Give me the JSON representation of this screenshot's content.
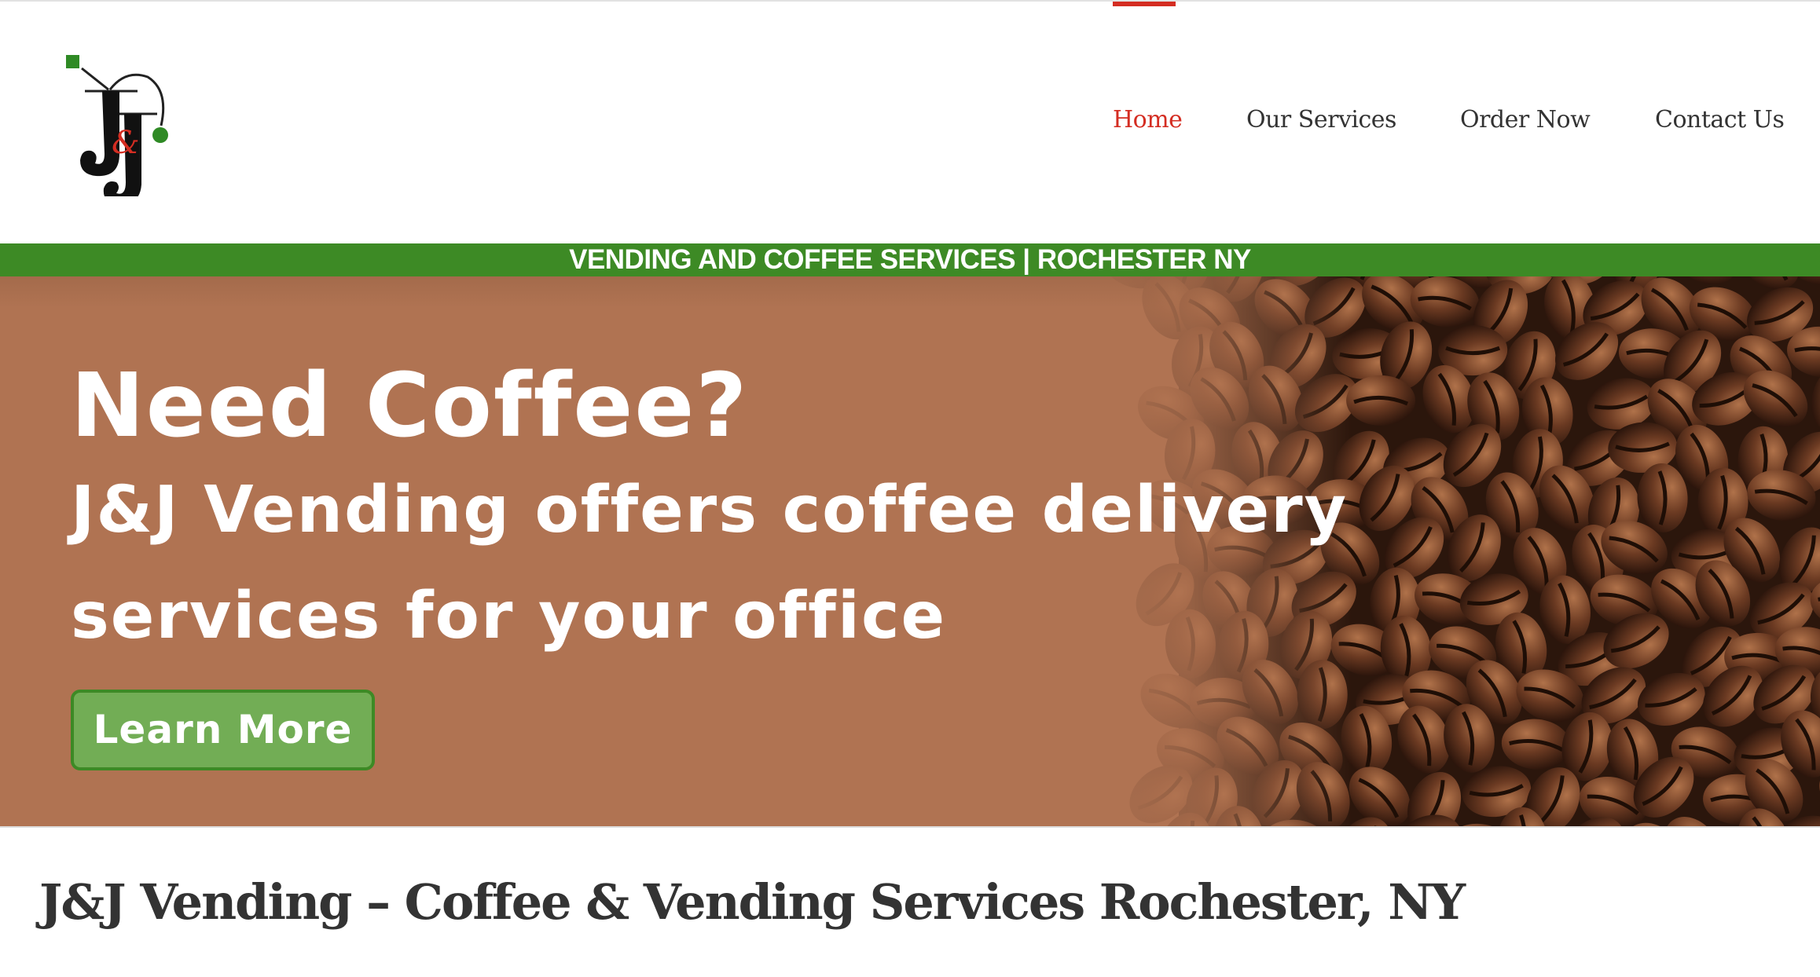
{
  "logo": {
    "text": "J&J",
    "colors": {
      "black": "#111111",
      "red": "#d42d22",
      "green": "#2f8a25"
    }
  },
  "nav": {
    "items": [
      {
        "label": "Home",
        "active": true
      },
      {
        "label": "Our Services"
      },
      {
        "label": "Order Now"
      },
      {
        "label": "Contact Us"
      }
    ]
  },
  "strip": {
    "text": "VENDING AND COFFEE SERVICES | ROCHESTER NY"
  },
  "hero": {
    "heading": "Need Coffee?",
    "line1": "J&J Vending offers coffee delivery",
    "line2": "services for your office",
    "button": "Learn More",
    "image": "coffee-beans"
  },
  "page": {
    "title": "J&J Vending – Coffee & Vending Services Rochester, NY"
  },
  "colors": {
    "accent": "#d42d22",
    "green": "#3d8a25",
    "hero_bg": "#b07352",
    "button": "#72ad55"
  }
}
